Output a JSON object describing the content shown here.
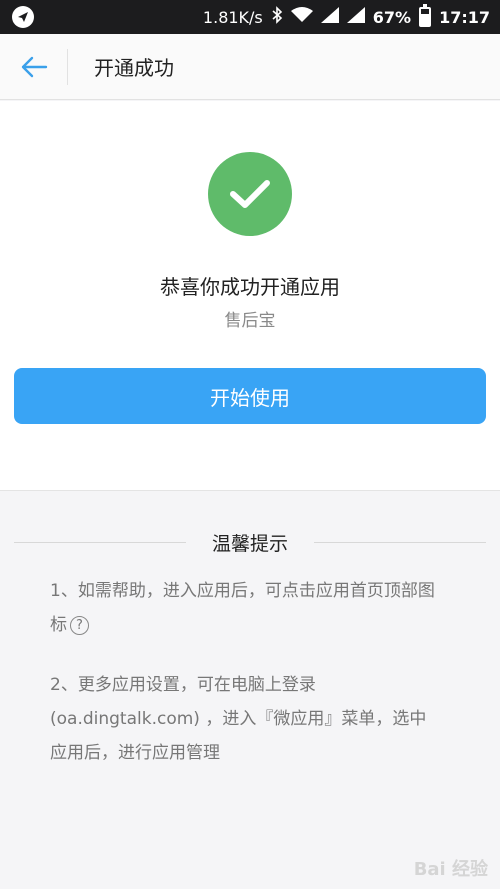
{
  "status_bar": {
    "speed": "1.81K/s",
    "battery": "67%",
    "battery_level": 0.67,
    "time": "17:17"
  },
  "nav": {
    "title": "开通成功",
    "back_icon": "back-arrow-icon"
  },
  "success": {
    "title": "恭喜你成功开通应用",
    "app_name": "售后宝",
    "button_label": "开始使用",
    "accent": "#5fbb6a"
  },
  "tips": {
    "heading": "温馨提示",
    "tip1": "1、如需帮助，进入应用后，可点击应用首页顶部图标",
    "tip2_line1": "2、更多应用设置，可在电脑上登录",
    "tip2_line2": "(oa.dingtalk.com) ，进入『微应用』菜单，选中",
    "tip2_line3": "应用后，进行应用管理"
  },
  "colors": {
    "primary_button": "#39a4f5",
    "status_bar_bg": "#1c1c1e"
  },
  "watermark": "Bai 经验"
}
